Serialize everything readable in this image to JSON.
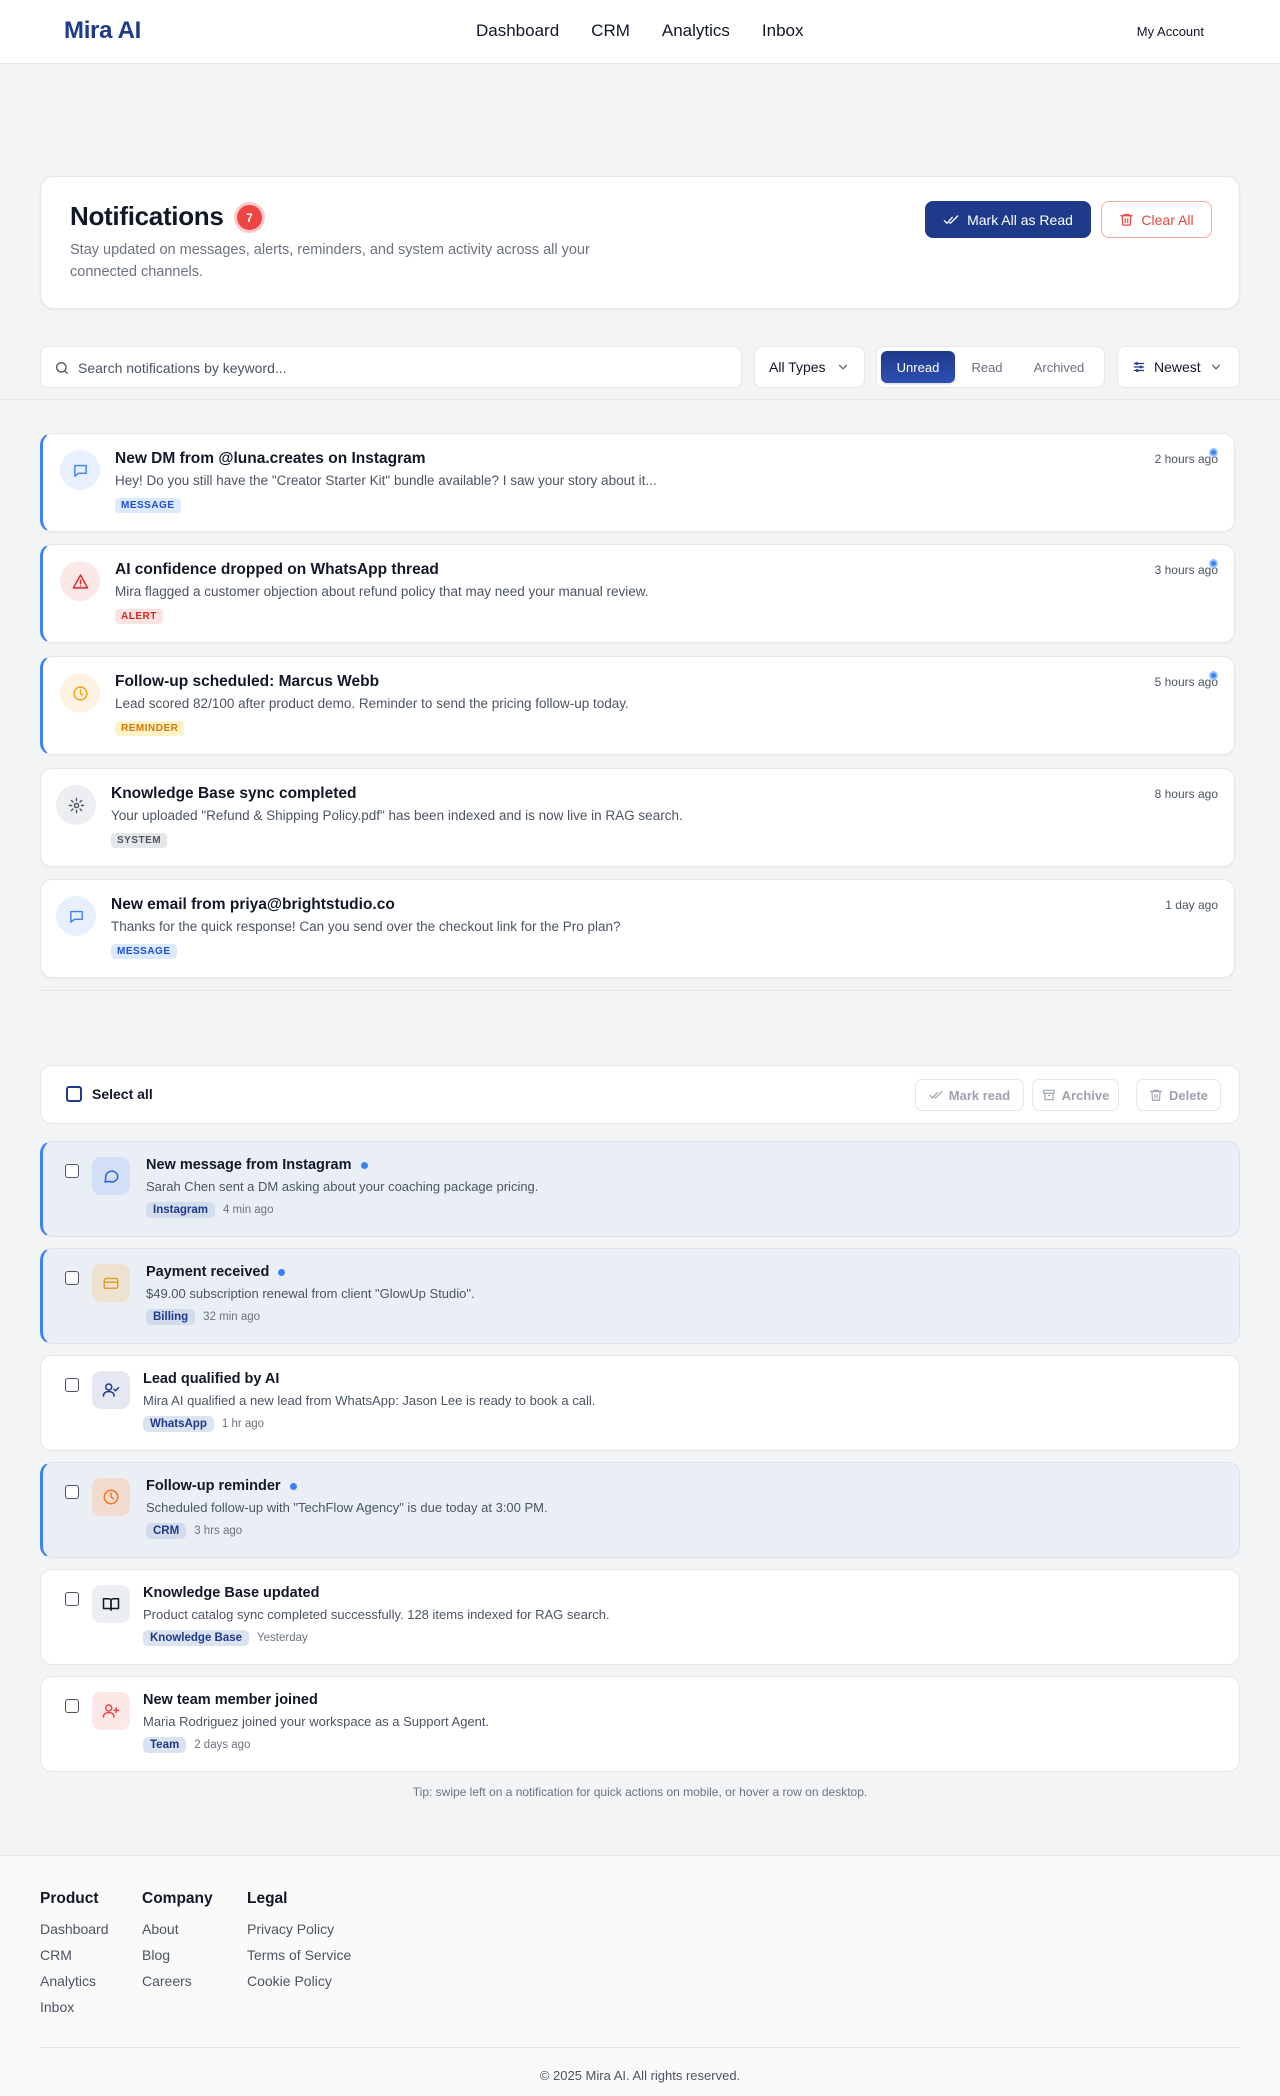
{
  "nav": {
    "logo": "Mira AI",
    "links": [
      "Dashboard",
      "CRM",
      "Analytics",
      "Inbox"
    ],
    "account": "My Account"
  },
  "header": {
    "title": "Notifications",
    "count": "7",
    "subtitle": "Stay updated on messages, alerts, reminders, and system activity across all your connected channels.",
    "mark_all_label": "Mark All as Read",
    "clear_all_label": "Clear All"
  },
  "filters": {
    "search_placeholder": "Search notifications by keyword...",
    "type_select": "All Types",
    "tabs": [
      "Unread",
      "Read",
      "Archived"
    ],
    "active_tab": "Unread",
    "sort": "Newest"
  },
  "notifications": [
    {
      "title": "New DM from @luna.creates on Instagram",
      "desc": "Hey! Do you still have the \"Creator Starter Kit\" bundle available? I saw your story about it...",
      "tag": "MESSAGE",
      "time": "2 hours ago",
      "unread": true,
      "icon": "message-icon"
    },
    {
      "title": "AI confidence dropped on WhatsApp thread",
      "desc": "Mira flagged a customer objection about refund policy that may need your manual review.",
      "tag": "ALERT",
      "time": "3 hours ago",
      "unread": true,
      "icon": "alert-triangle-icon"
    },
    {
      "title": "Follow-up scheduled: Marcus Webb",
      "desc": "Lead scored 82/100 after product demo. Reminder to send the pricing follow-up today.",
      "tag": "REMINDER",
      "time": "5 hours ago",
      "unread": true,
      "icon": "clock-icon"
    },
    {
      "title": "Knowledge Base sync completed",
      "desc": "Your uploaded \"Refund & Shipping Policy.pdf\" has been indexed and is now live in RAG search.",
      "tag": "SYSTEM",
      "time": "8 hours ago",
      "unread": false,
      "icon": "gear-icon"
    },
    {
      "title": "New email from priya@brightstudio.co",
      "desc": "Thanks for the quick response! Can you send over the checkout link for the Pro plan?",
      "tag": "MESSAGE",
      "time": "1 day ago",
      "unread": false,
      "icon": "message-icon"
    }
  ],
  "bulk": {
    "select_all": "Select all",
    "mark_read": "Mark read",
    "archive": "Archive",
    "delete": "Delete"
  },
  "activity": [
    {
      "title": "New message from Instagram",
      "desc": "Sarah Chen sent a DM asking about your coaching package pricing.",
      "chip": "Instagram",
      "time": "4 min ago",
      "unread": true,
      "icon": "chat-bubble-icon"
    },
    {
      "title": "Payment received",
      "desc": "$49.00 subscription renewal from client \"GlowUp Studio\".",
      "chip": "Billing",
      "time": "32 min ago",
      "unread": true,
      "icon": "credit-card-icon"
    },
    {
      "title": "Lead qualified by AI",
      "desc": "Mira AI qualified a new lead from WhatsApp: Jason Lee is ready to book a call.",
      "chip": "WhatsApp",
      "time": "1 hr ago",
      "unread": false,
      "icon": "user-check-icon"
    },
    {
      "title": "Follow-up reminder",
      "desc": "Scheduled follow-up with \"TechFlow Agency\" is due today at 3:00 PM.",
      "chip": "CRM",
      "time": "3 hrs ago",
      "unread": true,
      "icon": "clock-icon"
    },
    {
      "title": "Knowledge Base updated",
      "desc": "Product catalog sync completed successfully. 128 items indexed for RAG search.",
      "chip": "Knowledge Base",
      "time": "Yesterday",
      "unread": false,
      "icon": "book-open-icon"
    },
    {
      "title": "New team member joined",
      "desc": "Maria Rodriguez joined your workspace as a Support Agent.",
      "chip": "Team",
      "time": "2 days ago",
      "unread": false,
      "icon": "user-plus-icon"
    }
  ],
  "tip": "Tip: swipe left on a notification for quick actions on mobile, or hover a row on desktop.",
  "footer": {
    "columns": [
      {
        "heading": "Product",
        "links": [
          "Dashboard",
          "CRM",
          "Analytics",
          "Inbox"
        ]
      },
      {
        "heading": "Company",
        "links": [
          "About",
          "Blog",
          "Careers"
        ]
      },
      {
        "heading": "Legal",
        "links": [
          "Privacy Policy",
          "Terms of Service",
          "Cookie Policy"
        ]
      }
    ],
    "copyright": "© 2025 Mira AI. All rights reserved."
  },
  "colors": {
    "brand": "#1e3a8a",
    "accent": "#3b82f6",
    "danger": "#ef4444"
  }
}
